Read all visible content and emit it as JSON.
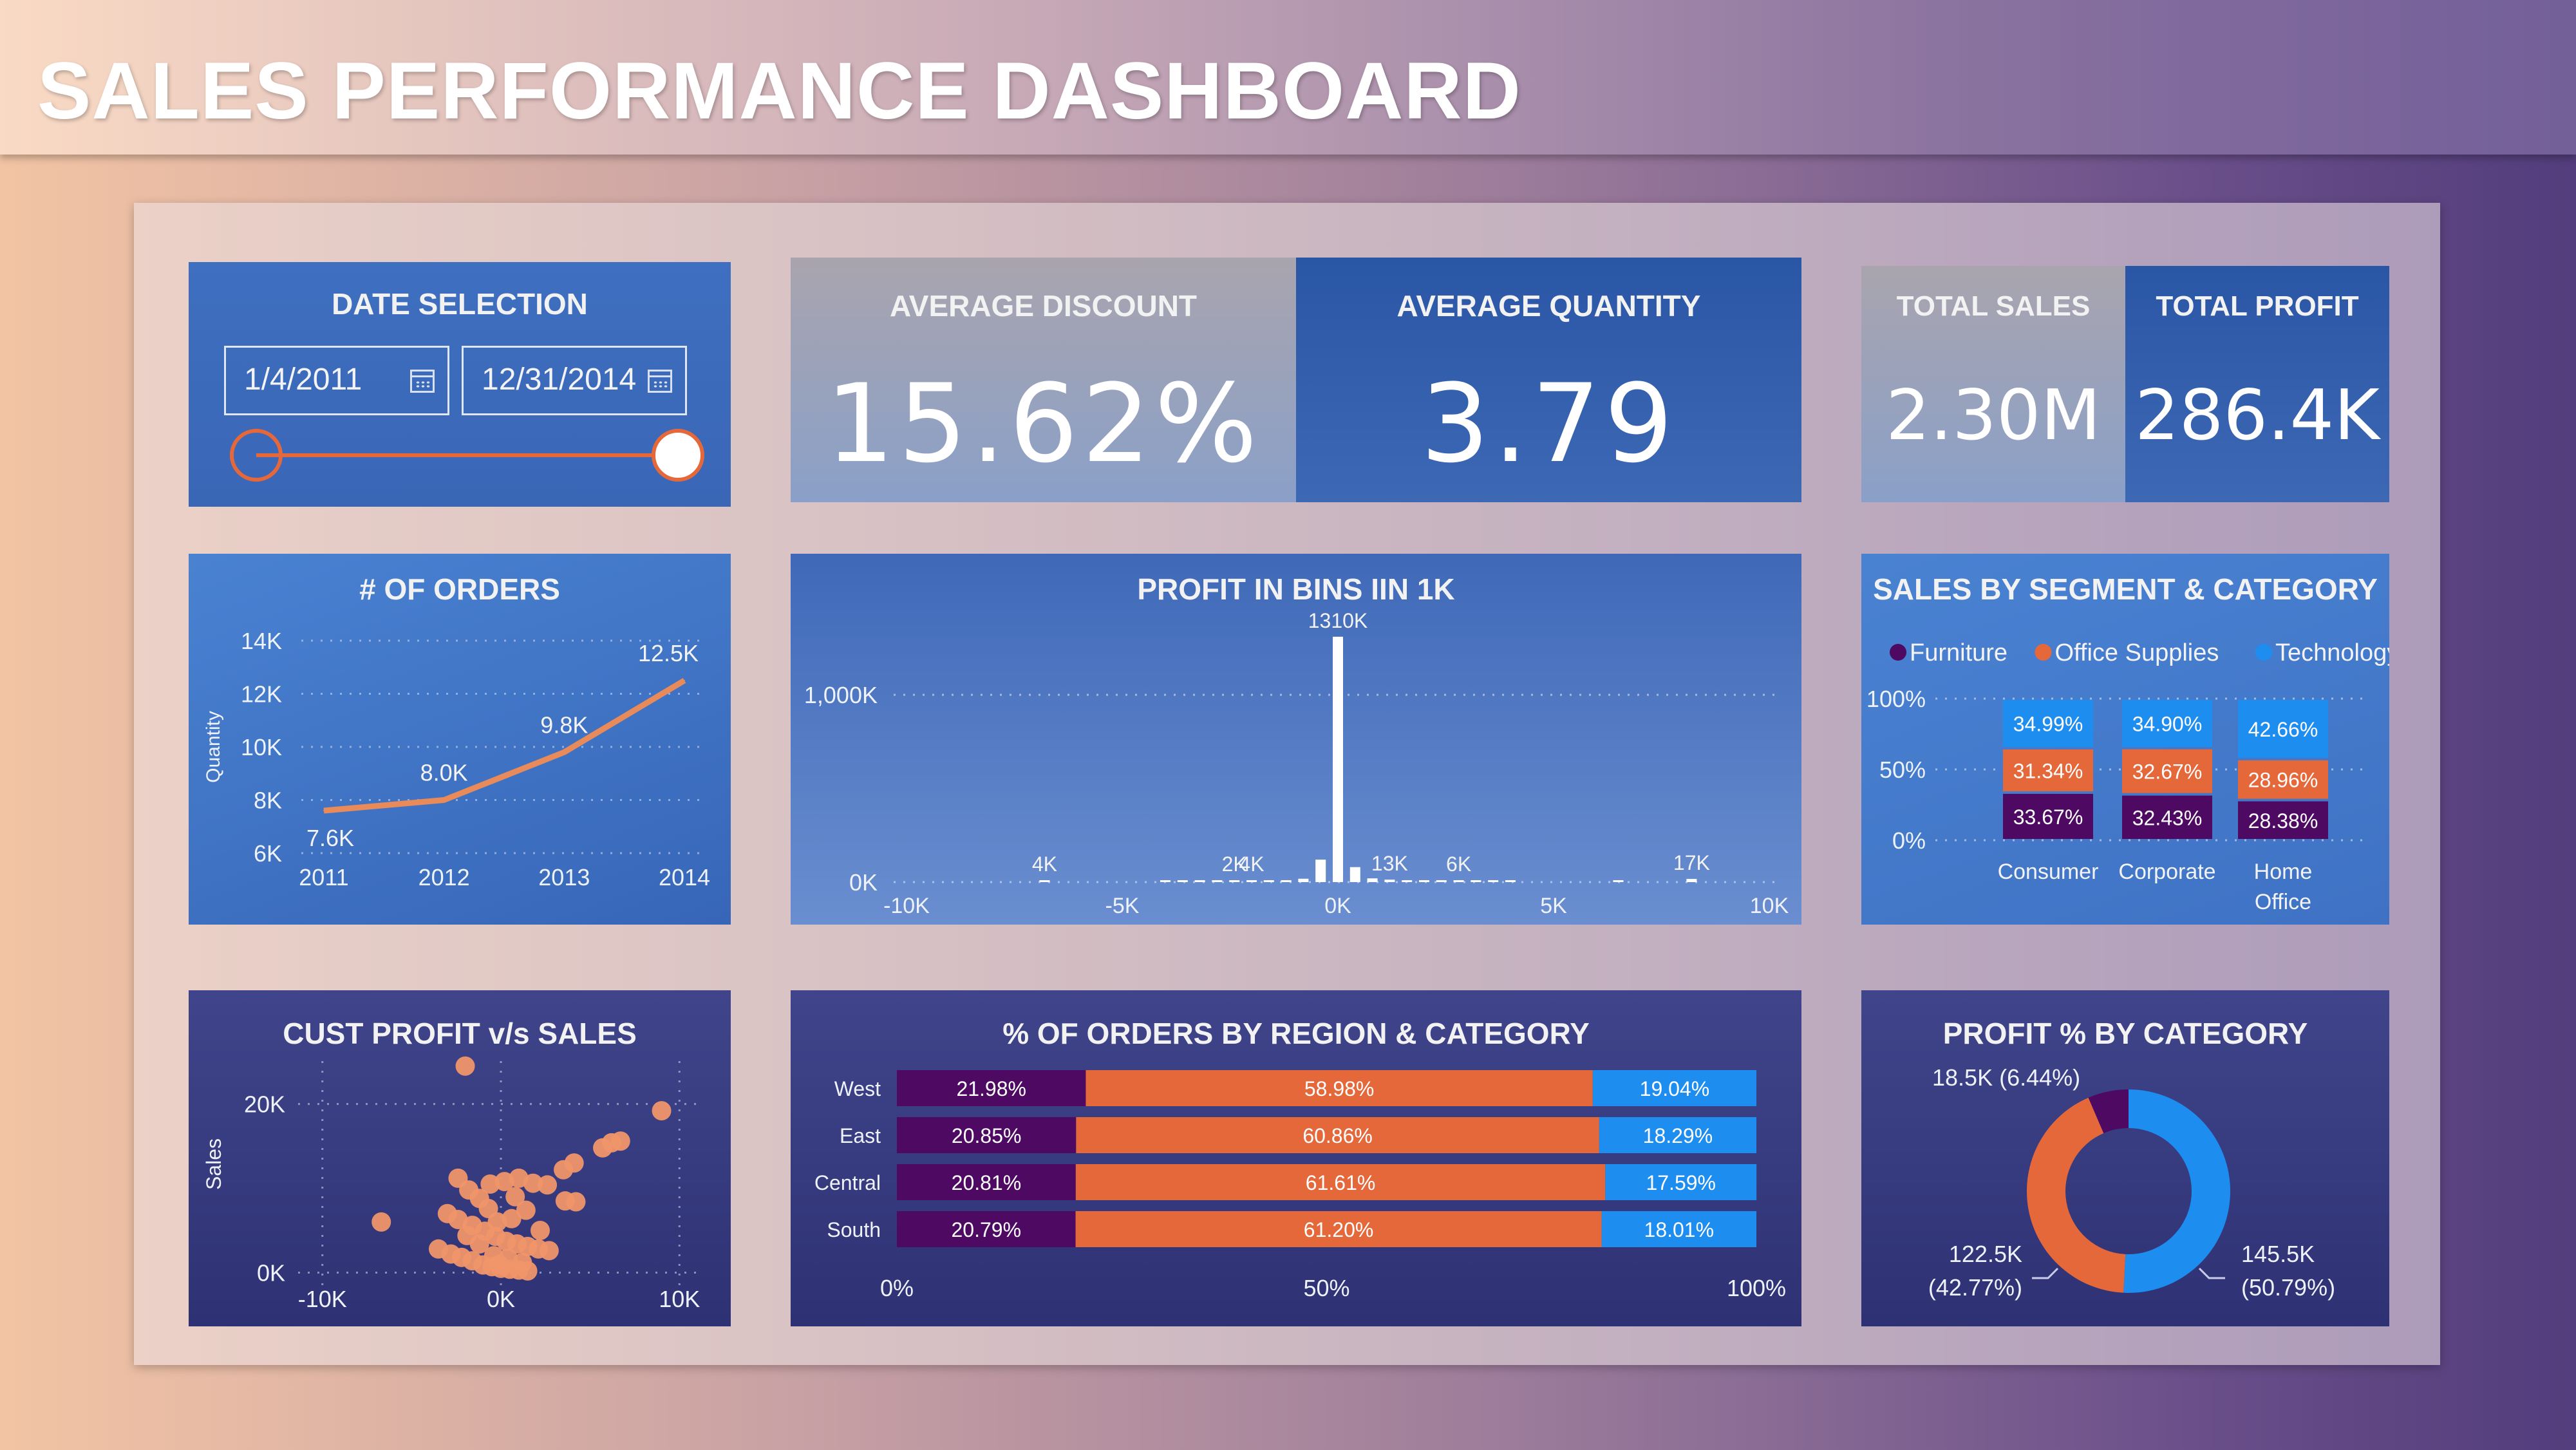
{
  "header": {
    "title": "SALES PERFORMANCE DASHBOARD"
  },
  "date_selection": {
    "title": "DATE SELECTION",
    "start": "1/4/2011",
    "end": "12/31/2014",
    "slider_start": 0,
    "slider_end": 1
  },
  "kpis": {
    "avg_discount": {
      "label": "AVERAGE DISCOUNT",
      "value": "15.62%"
    },
    "avg_quantity": {
      "label": "AVERAGE QUANTITY",
      "value": "3.79"
    },
    "total_sales": {
      "label": "TOTAL SALES",
      "value": "2.30M"
    },
    "total_profit": {
      "label": "TOTAL PROFIT",
      "value": "286.4K"
    }
  },
  "colors": {
    "furniture": "#4e0a63",
    "office_supplies": "#e5683a",
    "technology": "#1e8df0",
    "line": "#e88a5a",
    "scatter": "#f0956a"
  },
  "chart_data": [
    {
      "id": "orders",
      "type": "line",
      "title": "# OF ORDERS",
      "ylabel": "Quantity",
      "x": [
        "2011",
        "2012",
        "2013",
        "2014"
      ],
      "values": [
        7600,
        8000,
        9800,
        12500
      ],
      "data_labels": [
        "7.6K",
        "8.0K",
        "9.8K",
        "12.5K"
      ],
      "yticks": [
        "14K",
        "12K",
        "10K",
        "8K",
        "6K"
      ],
      "ylim": [
        6000,
        14000
      ]
    },
    {
      "id": "profit_bins",
      "type": "bar",
      "title": "PROFIT IN BINS  IIN 1K",
      "xticks": [
        "-10K",
        "-5K",
        "0K",
        "5K",
        "10K"
      ],
      "yticks": [
        "1,000K",
        "0K"
      ],
      "xlim": [
        -10,
        10
      ],
      "ylim": [
        0,
        1100
      ],
      "bins": [
        {
          "x": -6.8,
          "v": 4,
          "label": "4K"
        },
        {
          "x": -4.0,
          "v": 1
        },
        {
          "x": -3.6,
          "v": 1
        },
        {
          "x": -3.2,
          "v": 1
        },
        {
          "x": -2.8,
          "v": 2
        },
        {
          "x": -2.4,
          "v": 2,
          "label": "2K"
        },
        {
          "x": -2.0,
          "v": 4,
          "label": "4K"
        },
        {
          "x": -1.6,
          "v": 3
        },
        {
          "x": -1.2,
          "v": 6
        },
        {
          "x": -0.8,
          "v": 18
        },
        {
          "x": -0.4,
          "v": 120
        },
        {
          "x": 0.0,
          "v": 1310,
          "label": "1310K"
        },
        {
          "x": 0.4,
          "v": 80
        },
        {
          "x": 0.8,
          "v": 20
        },
        {
          "x": 1.2,
          "v": 13,
          "label": "13K"
        },
        {
          "x": 1.6,
          "v": 6
        },
        {
          "x": 2.0,
          "v": 4
        },
        {
          "x": 2.4,
          "v": 3
        },
        {
          "x": 2.8,
          "v": 6,
          "label": "6K"
        },
        {
          "x": 3.2,
          "v": 2
        },
        {
          "x": 3.6,
          "v": 1
        },
        {
          "x": 4.0,
          "v": 1
        },
        {
          "x": 6.5,
          "v": 1
        },
        {
          "x": 8.2,
          "v": 17,
          "label": "17K"
        }
      ]
    },
    {
      "id": "segment_category",
      "type": "bar",
      "title": "SALES BY SEGMENT & CATEGORY",
      "legend": [
        "Furniture",
        "Office Supplies",
        "Technology"
      ],
      "yticks": [
        "100%",
        "50%",
        "0%"
      ],
      "categories": [
        "Consumer",
        "Corporate",
        "Home Office"
      ],
      "series": [
        {
          "name": "Furniture",
          "values": [
            33.67,
            32.43,
            28.38
          ],
          "labels": [
            "33.67%",
            "32.43%",
            "28.38%"
          ]
        },
        {
          "name": "Office Supplies",
          "values": [
            31.34,
            32.67,
            28.96
          ],
          "labels": [
            "31.34%",
            "32.67%",
            "28.96%"
          ]
        },
        {
          "name": "Technology",
          "values": [
            34.99,
            34.9,
            42.66
          ],
          "labels": [
            "34.99%",
            "34.90%",
            "42.66%"
          ]
        }
      ]
    },
    {
      "id": "cust_profit_sales",
      "type": "scatter",
      "title": "CUST PROFIT  v/s SALES",
      "ylabel": "Sales",
      "xticks": [
        "-10K",
        "0K",
        "10K"
      ],
      "yticks": [
        "20K",
        "0K"
      ],
      "xlim": [
        -11000,
        11000
      ],
      "ylim": [
        -500,
        27000
      ],
      "points": [
        [
          -2000,
          24500
        ],
        [
          9000,
          19200
        ],
        [
          6700,
          15600
        ],
        [
          6200,
          15400
        ],
        [
          5700,
          14800
        ],
        [
          -6700,
          6000
        ],
        [
          4100,
          13000
        ],
        [
          3500,
          12200
        ],
        [
          -2400,
          11200
        ],
        [
          -1800,
          9800
        ],
        [
          -1200,
          8800
        ],
        [
          -600,
          10500
        ],
        [
          200,
          10800
        ],
        [
          1000,
          11200
        ],
        [
          1800,
          10600
        ],
        [
          2600,
          10400
        ],
        [
          3600,
          8500
        ],
        [
          4200,
          8400
        ],
        [
          -3000,
          7000
        ],
        [
          -2400,
          6300
        ],
        [
          -1600,
          5600
        ],
        [
          -900,
          4900
        ],
        [
          -300,
          4300
        ],
        [
          300,
          3700
        ],
        [
          900,
          3400
        ],
        [
          1500,
          3100
        ],
        [
          2100,
          2800
        ],
        [
          2700,
          2600
        ],
        [
          -3500,
          2800
        ],
        [
          -2800,
          2200
        ],
        [
          -2200,
          1800
        ],
        [
          -1600,
          1400
        ],
        [
          -1000,
          900
        ],
        [
          -500,
          700
        ],
        [
          0,
          500
        ],
        [
          500,
          400
        ],
        [
          1000,
          300
        ],
        [
          1500,
          200
        ],
        [
          -400,
          2000
        ],
        [
          400,
          1700
        ],
        [
          -1200,
          3400
        ],
        [
          1200,
          1200
        ],
        [
          -200,
          6000
        ],
        [
          600,
          6400
        ],
        [
          1400,
          7400
        ],
        [
          -700,
          7600
        ],
        [
          2200,
          5000
        ],
        [
          -1900,
          4400
        ],
        [
          800,
          9000
        ],
        [
          -100,
          1000
        ]
      ]
    },
    {
      "id": "region_category",
      "type": "bar",
      "title": "% OF ORDERS BY REGION & CATEGORY",
      "categories": [
        "West",
        "East",
        "Central",
        "South"
      ],
      "xticks": [
        "0%",
        "50%",
        "100%"
      ],
      "series": [
        {
          "name": "Furniture",
          "values": [
            21.98,
            20.85,
            20.81,
            20.79
          ],
          "labels": [
            "21.98%",
            "20.85%",
            "20.81%",
            "20.79%"
          ]
        },
        {
          "name": "Office Supplies",
          "values": [
            58.98,
            60.86,
            61.61,
            61.2
          ],
          "labels": [
            "58.98%",
            "60.86%",
            "61.61%",
            "61.20%"
          ]
        },
        {
          "name": "Technology",
          "values": [
            19.04,
            18.29,
            17.59,
            18.01
          ],
          "labels": [
            "19.04%",
            "18.29%",
            "17.59%",
            "18.01%"
          ]
        }
      ]
    },
    {
      "id": "profit_category",
      "type": "pie",
      "title": "PROFIT % BY CATEGORY",
      "slices": [
        {
          "name": "Technology",
          "value": 145.5,
          "pct": 50.79,
          "label1": "145.5K",
          "label2": "(50.79%)"
        },
        {
          "name": "Office Supplies",
          "value": 122.5,
          "pct": 42.77,
          "label1": "122.5K",
          "label2": "(42.77%)"
        },
        {
          "name": "Furniture",
          "value": 18.5,
          "pct": 6.44,
          "label1": "18.5K (6.44%)"
        }
      ]
    }
  ]
}
